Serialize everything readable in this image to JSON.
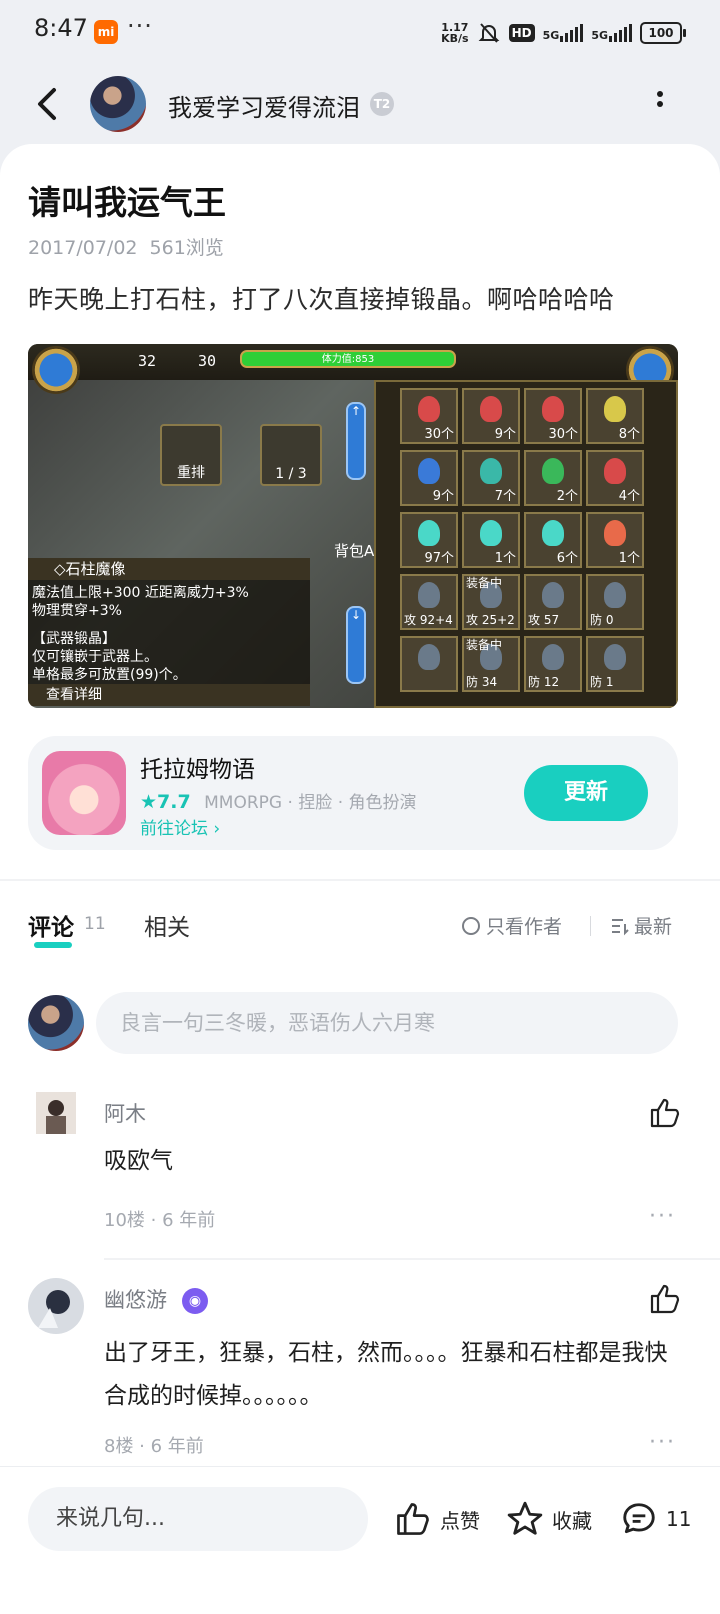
{
  "status_bar": {
    "time": "8:47",
    "mi_label": "mi",
    "more": "···",
    "speed_value": "1.17",
    "speed_unit": "KB/s",
    "hd": "HD",
    "net1": "5G",
    "net2": "5G",
    "battery": "100"
  },
  "header": {
    "author_name": "我爱学习爱得流泪",
    "level_badge": "T2"
  },
  "post": {
    "title": "请叫我运气王",
    "date": "2017/07/02",
    "views": "561浏览",
    "body": "昨天晚上打石柱，打了八次直接掉锻晶。啊哈哈哈哈"
  },
  "screenshot": {
    "level": "32",
    "count": "30",
    "hp_label": "体力值:853",
    "btn_sort": "重排",
    "btn_page": "1 / 3",
    "bag": "背包A",
    "info_title": "◇石柱魔像",
    "info_line1": "魔法值上限+300 近距离威力+3%",
    "info_line2": "物理贯穿+3%",
    "info_line3": "【武器锻晶】",
    "info_line4": "仅可镶嵌于武器上。",
    "info_line5": "单格最多可放置(99)个。",
    "info_detail": "查看详细",
    "cells": [
      {
        "count": "30个",
        "color": "#d84a4a"
      },
      {
        "count": "9个",
        "color": "#d84a4a"
      },
      {
        "count": "30个",
        "color": "#d84a4a"
      },
      {
        "count": "8个",
        "color": "#d8c84a"
      },
      {
        "count": "9个",
        "color": "#3a7ad8"
      },
      {
        "count": "7个",
        "color": "#3ab8a8"
      },
      {
        "count": "2个",
        "color": "#3ab85a"
      },
      {
        "count": "4个",
        "color": "#d84a4a"
      },
      {
        "count": "97个",
        "color": "#4ad8c8"
      },
      {
        "count": "1个",
        "color": "#4ad8c8"
      },
      {
        "count": "6个",
        "color": "#4ad8c8"
      },
      {
        "count": "1个",
        "color": "#e86a4a"
      }
    ],
    "equip_cells": [
      {
        "stat": "攻  92+4",
        "equip": ""
      },
      {
        "stat": "攻  25+2",
        "equip": "装备中"
      },
      {
        "stat": "攻    57",
        "equip": ""
      },
      {
        "stat": "防     0",
        "equip": ""
      },
      {
        "stat": "",
        "equip": ""
      },
      {
        "stat": "防    34",
        "equip": "装备中"
      },
      {
        "stat": "防    12",
        "equip": ""
      },
      {
        "stat": "防     1",
        "equip": ""
      }
    ]
  },
  "game": {
    "name": "托拉姆物语",
    "rating": "7.7",
    "tags": "MMORPG · 捏脸 · 角色扮演",
    "forum_link": "前往论坛",
    "update_button": "更新"
  },
  "tabs": {
    "comments_label": "评论",
    "comments_count": "11",
    "related_label": "相关",
    "only_author": "只看作者",
    "latest": "最新"
  },
  "comment_input": {
    "placeholder": "良言一句三冬暖，恶语伤人六月寒"
  },
  "comments": [
    {
      "name": "阿木",
      "text": "吸欧气",
      "floor": "10楼",
      "time": "6 年前",
      "more": "···"
    },
    {
      "name": "幽悠游",
      "text": "出了牙王，狂暴，石柱，然而。。。。狂暴和石柱都是我快合成的时候掉。。。。。。",
      "floor": "8楼",
      "time": "6 年前",
      "more": "···"
    }
  ],
  "bottom_bar": {
    "input_placeholder": "来说几句...",
    "like": "点赞",
    "collect": "收藏",
    "comment_count": "11"
  },
  "colors": {
    "accent": "#19cfc0",
    "background": "#eef0f4",
    "card": "#ffffff"
  }
}
